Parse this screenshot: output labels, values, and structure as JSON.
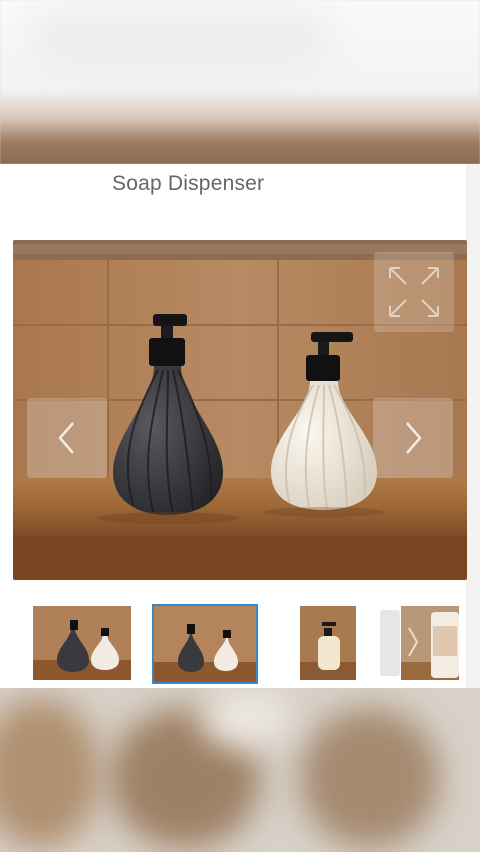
{
  "dialog": {
    "title": "Soap Dispenser"
  },
  "viewer": {
    "prev_icon": "chevron-left-icon",
    "next_icon": "chevron-right-icon",
    "expand_icon": "expand-icon"
  },
  "thumbnails": [
    {
      "name": "thumbnail-1",
      "selected": false
    },
    {
      "name": "thumbnail-2",
      "selected": true
    },
    {
      "name": "thumbnail-3",
      "selected": false
    },
    {
      "name": "thumbnail-4",
      "selected": false
    }
  ],
  "colors": {
    "selected_border": "#3b87c6",
    "title_text": "#666666",
    "shelf": "#8a5a33",
    "wall": "#b08460"
  }
}
